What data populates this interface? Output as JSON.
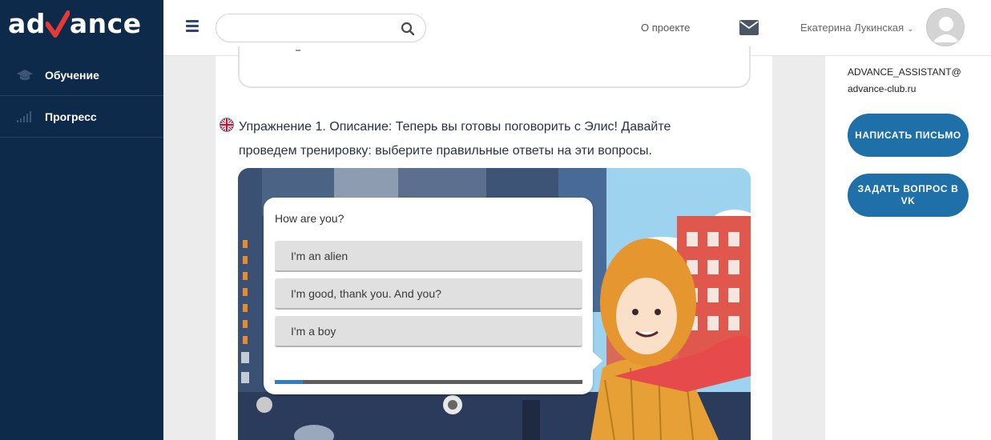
{
  "brand": {
    "logo_text_left": "ad",
    "logo_text_right": "ance",
    "accent": "#e63a37"
  },
  "sidebar": {
    "items": [
      {
        "label": "Обучение",
        "icon": "graduation-cap-icon"
      },
      {
        "label": "Прогресс",
        "icon": "signal-bars-icon"
      }
    ]
  },
  "header": {
    "search": {
      "placeholder": ""
    },
    "about_label": "О проекте",
    "user_name": "Екатерина Лукинская",
    "user_chevron": "⌄"
  },
  "exercise": {
    "title": "Упражнение 1. Описание: Теперь вы готовы поговорить с Элис! Давайте проведем тренировку: выберите правильные ответы на эти вопросы.",
    "quiz": {
      "question": "How are you?",
      "answers": [
        "I'm an alien",
        "I'm good, thank you. And you?",
        "I'm a boy"
      ],
      "progress_fraction": 0.09
    }
  },
  "right_panel": {
    "email_line1": "ADVANCE_ASSISTANT@",
    "email_line2": "advance-club.ru",
    "write_button": "НАПИСАТЬ ПИСЬМО",
    "vk_button": "ЗАДАТЬ ВОПРОС В VK"
  },
  "colors": {
    "sidebar_bg": "#0e2a4a",
    "button_blue": "#1f6fa8",
    "progress_blue": "#2f7fc5"
  }
}
